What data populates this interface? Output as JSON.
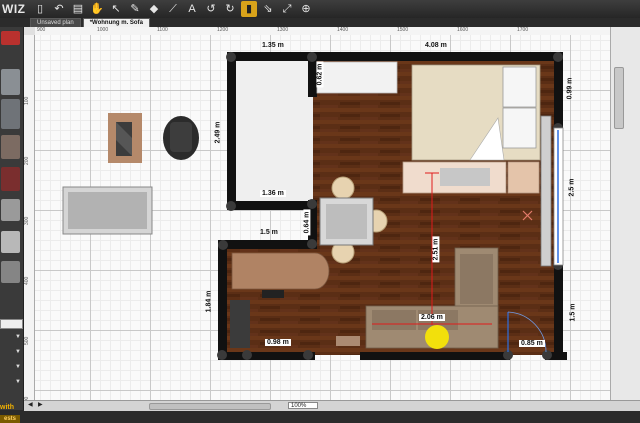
{
  "app": {
    "logo": "WIZ"
  },
  "toolbar": {
    "icons": [
      {
        "name": "new-file-icon",
        "glyph": "▯"
      },
      {
        "name": "undo-arrow-icon",
        "glyph": "↶"
      },
      {
        "name": "print-icon",
        "glyph": "▤"
      },
      {
        "name": "hand-pan-icon",
        "glyph": "✋"
      },
      {
        "name": "select-arrow-icon",
        "glyph": "↖"
      },
      {
        "name": "pen-draw-icon",
        "glyph": "✎"
      },
      {
        "name": "paint-bucket-icon",
        "glyph": "◆"
      },
      {
        "name": "measure-icon",
        "glyph": "⟋"
      },
      {
        "name": "text-icon",
        "glyph": "A"
      },
      {
        "name": "undo-icon",
        "glyph": "↺"
      },
      {
        "name": "redo-icon",
        "glyph": "↻"
      },
      {
        "name": "snap-icon",
        "glyph": "▮"
      },
      {
        "name": "rotate-icon",
        "glyph": "⇘"
      },
      {
        "name": "fit-view-icon",
        "glyph": "⤢"
      },
      {
        "name": "zoom-icon",
        "glyph": "⊕"
      }
    ],
    "active_index": 11
  },
  "tabs": [
    {
      "label": "Unsaved plan",
      "active": false
    },
    {
      "label": "*Wohnung m. Sofa",
      "active": true
    }
  ],
  "ruler": {
    "top": [
      "900",
      "1000",
      "1100",
      "1200",
      "1300",
      "1400",
      "1500",
      "1600",
      "1700"
    ],
    "left": [
      "100",
      "200",
      "300",
      "400",
      "500",
      "600"
    ]
  },
  "plan": {
    "dimensions": {
      "top_left": "1.35 m",
      "top_right": "4.08 m",
      "closet_height": "0.62 m",
      "right_upper": "0.99 m",
      "left_room_height": "2.49 m",
      "left_room_width": "1.36 m",
      "right_mid": "2.5 m",
      "mid_left": "1.5 m",
      "mid_pillar": "0.64 m",
      "center_vertical": "2.51 m",
      "lower_left_height": "1.84 m",
      "sofa_width": "2.06 m",
      "bottom_left": "0.98 m",
      "bottom_right": "0.85 m",
      "right_lower": "1.5 m"
    }
  },
  "sidebar": {
    "promo_line1": "with",
    "promo_line2": "ests"
  },
  "statusbar": {
    "zoom": "100%",
    "nav_prev": "◀",
    "nav_next": "▶"
  },
  "colors": {
    "floor": "#5b2e15",
    "wall": "#111111",
    "accent": "#d9a31a",
    "highlight": "#f2e00c"
  }
}
